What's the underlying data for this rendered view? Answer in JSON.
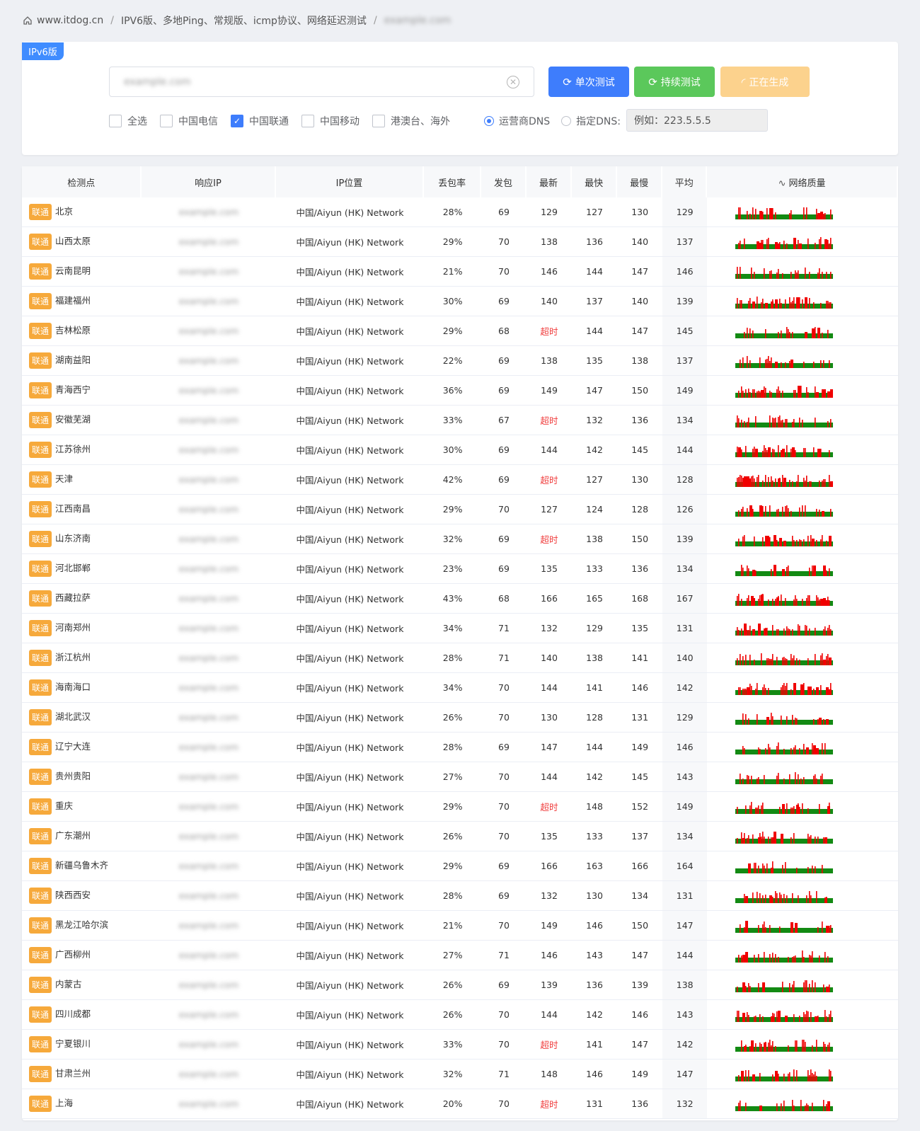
{
  "breadcrumb": {
    "home": "www.itdog.cn",
    "page": "IPV6版、多地Ping、常规版、icmp协议、网络延迟测试",
    "target": "example.com"
  },
  "tag": "IPv6版",
  "search": {
    "value": "example.com"
  },
  "buttons": {
    "single": "单次测试",
    "continuous": "持续测试",
    "generating": "正在生成"
  },
  "options": [
    {
      "label": "全选",
      "checked": false
    },
    {
      "label": "中国电信",
      "checked": false
    },
    {
      "label": "中国联通",
      "checked": true
    },
    {
      "label": "中国移动",
      "checked": false
    },
    {
      "label": "港澳台、海外",
      "checked": false
    }
  ],
  "dns": {
    "isp_label": "运营商DNS",
    "custom_label": "指定DNS:",
    "placeholder": "例如：223.5.5.5",
    "selected": "isp"
  },
  "columns": [
    "检测点",
    "响应IP",
    "IP位置",
    "丢包率",
    "发包",
    "最新",
    "最快",
    "最慢",
    "平均",
    "网络质量"
  ],
  "colors": {
    "primary": "#3e7dfc",
    "success": "#5bc85b",
    "warning": "#fcd28d",
    "badge": "#f6a93b",
    "good": "#138a13",
    "bad": "#f00000"
  },
  "rows": [
    {
      "isp": "联通",
      "node": "北京",
      "ip": "example.com",
      "loc": "中国/Aiyun (HK) Network",
      "loss": "28%",
      "sent": "69",
      "latest": "129",
      "fast": "127",
      "slow": "130",
      "avg": "129"
    },
    {
      "isp": "联通",
      "node": "山西太原",
      "ip": "example.com",
      "loc": "中国/Aiyun (HK) Network",
      "loss": "29%",
      "sent": "70",
      "latest": "138",
      "fast": "136",
      "slow": "140",
      "avg": "137"
    },
    {
      "isp": "联通",
      "node": "云南昆明",
      "ip": "example.com",
      "loc": "中国/Aiyun (HK) Network",
      "loss": "21%",
      "sent": "70",
      "latest": "146",
      "fast": "144",
      "slow": "147",
      "avg": "146"
    },
    {
      "isp": "联通",
      "node": "福建福州",
      "ip": "example.com",
      "loc": "中国/Aiyun (HK) Network",
      "loss": "30%",
      "sent": "69",
      "latest": "140",
      "fast": "137",
      "slow": "140",
      "avg": "139"
    },
    {
      "isp": "联通",
      "node": "吉林松原",
      "ip": "example.com",
      "loc": "中国/Aiyun (HK) Network",
      "loss": "29%",
      "sent": "68",
      "latest": "超时",
      "fast": "144",
      "slow": "147",
      "avg": "145"
    },
    {
      "isp": "联通",
      "node": "湖南益阳",
      "ip": "example.com",
      "loc": "中国/Aiyun (HK) Network",
      "loss": "22%",
      "sent": "69",
      "latest": "138",
      "fast": "135",
      "slow": "138",
      "avg": "137"
    },
    {
      "isp": "联通",
      "node": "青海西宁",
      "ip": "example.com",
      "loc": "中国/Aiyun (HK) Network",
      "loss": "36%",
      "sent": "69",
      "latest": "149",
      "fast": "147",
      "slow": "150",
      "avg": "149"
    },
    {
      "isp": "联通",
      "node": "安徽芜湖",
      "ip": "example.com",
      "loc": "中国/Aiyun (HK) Network",
      "loss": "33%",
      "sent": "67",
      "latest": "超时",
      "fast": "132",
      "slow": "136",
      "avg": "134"
    },
    {
      "isp": "联通",
      "node": "江苏徐州",
      "ip": "example.com",
      "loc": "中国/Aiyun (HK) Network",
      "loss": "30%",
      "sent": "69",
      "latest": "144",
      "fast": "142",
      "slow": "145",
      "avg": "144"
    },
    {
      "isp": "联通",
      "node": "天津",
      "ip": "example.com",
      "loc": "中国/Aiyun (HK) Network",
      "loss": "42%",
      "sent": "69",
      "latest": "超时",
      "fast": "127",
      "slow": "130",
      "avg": "128"
    },
    {
      "isp": "联通",
      "node": "江西南昌",
      "ip": "example.com",
      "loc": "中国/Aiyun (HK) Network",
      "loss": "29%",
      "sent": "70",
      "latest": "127",
      "fast": "124",
      "slow": "128",
      "avg": "126"
    },
    {
      "isp": "联通",
      "node": "山东济南",
      "ip": "example.com",
      "loc": "中国/Aiyun (HK) Network",
      "loss": "32%",
      "sent": "69",
      "latest": "超时",
      "fast": "138",
      "slow": "150",
      "avg": "139"
    },
    {
      "isp": "联通",
      "node": "河北邯郸",
      "ip": "example.com",
      "loc": "中国/Aiyun (HK) Network",
      "loss": "23%",
      "sent": "69",
      "latest": "135",
      "fast": "133",
      "slow": "136",
      "avg": "134"
    },
    {
      "isp": "联通",
      "node": "西藏拉萨",
      "ip": "example.com",
      "loc": "中国/Aiyun (HK) Network",
      "loss": "43%",
      "sent": "68",
      "latest": "166",
      "fast": "165",
      "slow": "168",
      "avg": "167"
    },
    {
      "isp": "联通",
      "node": "河南郑州",
      "ip": "example.com",
      "loc": "中国/Aiyun (HK) Network",
      "loss": "34%",
      "sent": "71",
      "latest": "132",
      "fast": "129",
      "slow": "135",
      "avg": "131"
    },
    {
      "isp": "联通",
      "node": "浙江杭州",
      "ip": "example.com",
      "loc": "中国/Aiyun (HK) Network",
      "loss": "28%",
      "sent": "71",
      "latest": "140",
      "fast": "138",
      "slow": "141",
      "avg": "140"
    },
    {
      "isp": "联通",
      "node": "海南海口",
      "ip": "example.com",
      "loc": "中国/Aiyun (HK) Network",
      "loss": "34%",
      "sent": "70",
      "latest": "144",
      "fast": "141",
      "slow": "146",
      "avg": "142"
    },
    {
      "isp": "联通",
      "node": "湖北武汉",
      "ip": "example.com",
      "loc": "中国/Aiyun (HK) Network",
      "loss": "26%",
      "sent": "70",
      "latest": "130",
      "fast": "128",
      "slow": "131",
      "avg": "129"
    },
    {
      "isp": "联通",
      "node": "辽宁大连",
      "ip": "example.com",
      "loc": "中国/Aiyun (HK) Network",
      "loss": "28%",
      "sent": "69",
      "latest": "147",
      "fast": "144",
      "slow": "149",
      "avg": "146"
    },
    {
      "isp": "联通",
      "node": "贵州贵阳",
      "ip": "example.com",
      "loc": "中国/Aiyun (HK) Network",
      "loss": "27%",
      "sent": "70",
      "latest": "144",
      "fast": "142",
      "slow": "145",
      "avg": "143"
    },
    {
      "isp": "联通",
      "node": "重庆",
      "ip": "example.com",
      "loc": "中国/Aiyun (HK) Network",
      "loss": "29%",
      "sent": "70",
      "latest": "超时",
      "fast": "148",
      "slow": "152",
      "avg": "149"
    },
    {
      "isp": "联通",
      "node": "广东潮州",
      "ip": "example.com",
      "loc": "中国/Aiyun (HK) Network",
      "loss": "26%",
      "sent": "70",
      "latest": "135",
      "fast": "133",
      "slow": "137",
      "avg": "134"
    },
    {
      "isp": "联通",
      "node": "新疆乌鲁木齐",
      "ip": "example.com",
      "loc": "中国/Aiyun (HK) Network",
      "loss": "29%",
      "sent": "69",
      "latest": "166",
      "fast": "163",
      "slow": "166",
      "avg": "164"
    },
    {
      "isp": "联通",
      "node": "陕西西安",
      "ip": "example.com",
      "loc": "中国/Aiyun (HK) Network",
      "loss": "28%",
      "sent": "69",
      "latest": "132",
      "fast": "130",
      "slow": "134",
      "avg": "131"
    },
    {
      "isp": "联通",
      "node": "黑龙江哈尔滨",
      "ip": "example.com",
      "loc": "中国/Aiyun (HK) Network",
      "loss": "21%",
      "sent": "70",
      "latest": "149",
      "fast": "146",
      "slow": "150",
      "avg": "147"
    },
    {
      "isp": "联通",
      "node": "广西柳州",
      "ip": "example.com",
      "loc": "中国/Aiyun (HK) Network",
      "loss": "27%",
      "sent": "71",
      "latest": "146",
      "fast": "143",
      "slow": "147",
      "avg": "144"
    },
    {
      "isp": "联通",
      "node": "内蒙古",
      "ip": "example.com",
      "loc": "中国/Aiyun (HK) Network",
      "loss": "26%",
      "sent": "69",
      "latest": "139",
      "fast": "136",
      "slow": "139",
      "avg": "138"
    },
    {
      "isp": "联通",
      "node": "四川成都",
      "ip": "example.com",
      "loc": "中国/Aiyun (HK) Network",
      "loss": "26%",
      "sent": "70",
      "latest": "144",
      "fast": "142",
      "slow": "146",
      "avg": "143"
    },
    {
      "isp": "联通",
      "node": "宁夏银川",
      "ip": "example.com",
      "loc": "中国/Aiyun (HK) Network",
      "loss": "33%",
      "sent": "70",
      "latest": "超时",
      "fast": "141",
      "slow": "147",
      "avg": "142"
    },
    {
      "isp": "联通",
      "node": "甘肃兰州",
      "ip": "example.com",
      "loc": "中国/Aiyun (HK) Network",
      "loss": "32%",
      "sent": "71",
      "latest": "148",
      "fast": "146",
      "slow": "149",
      "avg": "147"
    },
    {
      "isp": "联通",
      "node": "上海",
      "ip": "example.com",
      "loc": "中国/Aiyun (HK) Network",
      "loss": "20%",
      "sent": "70",
      "latest": "超时",
      "fast": "131",
      "slow": "136",
      "avg": "132"
    }
  ]
}
